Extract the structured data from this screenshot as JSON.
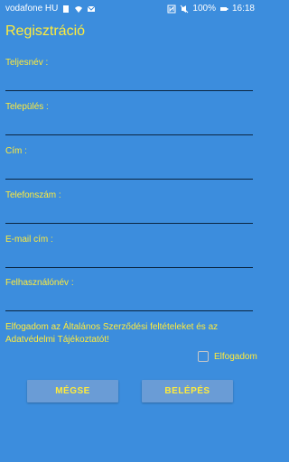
{
  "status_bar": {
    "carrier": "vodafone HU",
    "battery": "100%",
    "time": "16:18",
    "left_icons": [
      "sim-icon",
      "wifi-icon",
      "mail-icon"
    ],
    "right_icons": [
      "nfc-icon",
      "mute-icon",
      "battery-icon"
    ]
  },
  "screen": {
    "title": "Regisztráció"
  },
  "form": {
    "fields": [
      {
        "label": "Teljesnév :",
        "value": ""
      },
      {
        "label": "Település :",
        "value": ""
      },
      {
        "label": "Cím :",
        "value": ""
      },
      {
        "label": "Telefonszám :",
        "value": ""
      },
      {
        "label": "E-mail cím :",
        "value": ""
      },
      {
        "label": "Felhasználónév :",
        "value": ""
      }
    ],
    "terms_text": "Elfogadom az Általános Szerződési feltételeket és az Adatvédelmi Tájékoztatót!",
    "accept_label": "Elfogadom",
    "accept_checked": false
  },
  "buttons": {
    "cancel": "MÉGSE",
    "login": "BELÉPÉS"
  },
  "colors": {
    "background": "#3c8ddd",
    "accent_text": "#ffeb3b",
    "button": "#6a9cd6"
  }
}
